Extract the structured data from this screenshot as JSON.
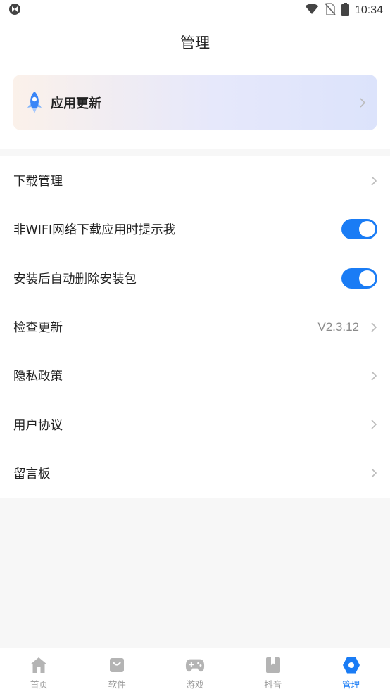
{
  "status_bar": {
    "time": "10:34",
    "icons": [
      "app-status-icon",
      "wifi-icon",
      "no-sim-icon",
      "battery-icon"
    ]
  },
  "header": {
    "title": "管理"
  },
  "update_card": {
    "title": "应用更新",
    "icon": "rocket-icon"
  },
  "settings": {
    "download_manage": "下载管理",
    "wifi_prompt": {
      "label": "非WIFI网络下载应用时提示我",
      "enabled": true
    },
    "auto_delete": {
      "label": "安装后自动删除安装包",
      "enabled": true
    },
    "check_update": {
      "label": "检查更新",
      "version": "V2.3.12"
    },
    "privacy": "隐私政策",
    "user_agreement": "用户协议",
    "message_board": "留言板"
  },
  "tabs": [
    {
      "label": "首页",
      "icon": "home-icon",
      "active": false
    },
    {
      "label": "软件",
      "icon": "bag-icon",
      "active": false
    },
    {
      "label": "游戏",
      "icon": "gamepad-icon",
      "active": false
    },
    {
      "label": "抖音",
      "icon": "bookmark-icon",
      "active": false
    },
    {
      "label": "管理",
      "icon": "hexagon-icon",
      "active": true
    }
  ],
  "colors": {
    "accent": "#1a7cf5",
    "inactive": "#b4b4b4",
    "background": "#f7f7f7"
  }
}
